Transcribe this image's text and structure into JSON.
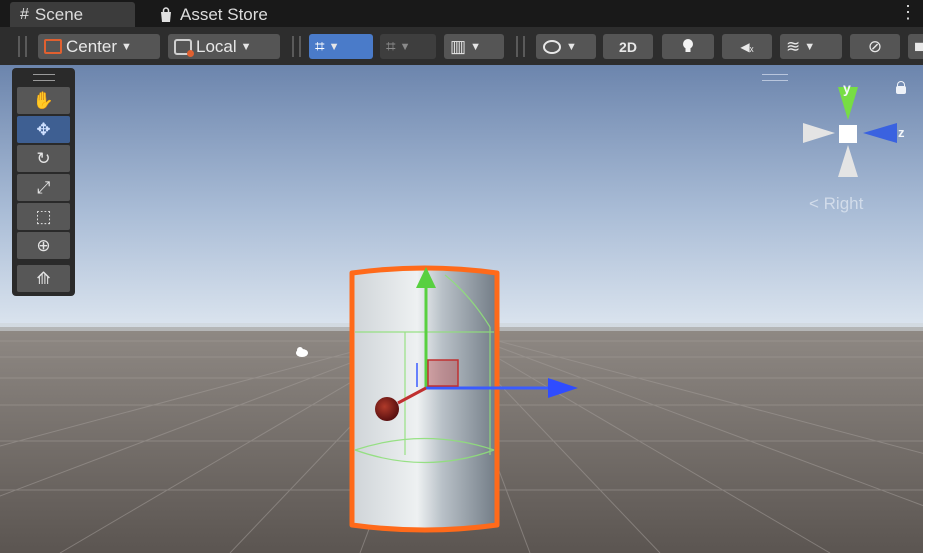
{
  "tabs": [
    {
      "icon": "#",
      "label": "Scene"
    },
    {
      "icon": "bag-icon",
      "label": "Asset Store"
    }
  ],
  "toolbar": {
    "pivot_label": "Center",
    "space_label": "Local",
    "mode_2d_label": "2D"
  },
  "palette": {
    "tools": [
      "hand-tool",
      "move-tool",
      "rotate-tool",
      "scale-tool",
      "rect-tool",
      "transform-tool",
      "custom-tool"
    ],
    "active_tool": "move-tool"
  },
  "gizmo": {
    "y_label": "y",
    "z_label": "z",
    "view_label": "< Right"
  },
  "colors": {
    "selection_outline": "#ff6a1a",
    "axis_x": "#c03030",
    "axis_y": "#58d040",
    "axis_z": "#3a5cff",
    "toolbar_active": "#4a7bc9"
  }
}
